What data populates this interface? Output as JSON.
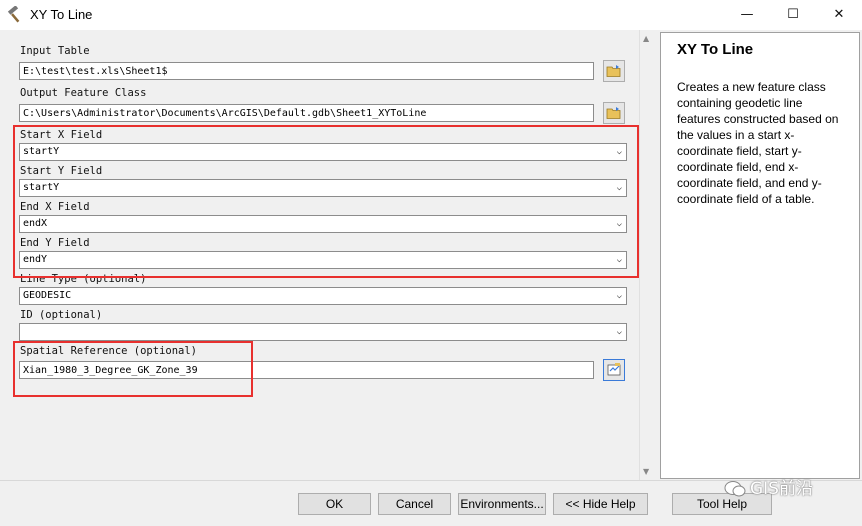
{
  "window": {
    "title": "XY To Line",
    "minimize_glyph": "—",
    "maximize_glyph": "☐",
    "close_glyph": "✕",
    "icon": "hammer-icon"
  },
  "params": {
    "input_table": {
      "label": "Input Table",
      "value": "E:\\test\\test.xls\\Sheet1$"
    },
    "output_feature_class": {
      "label": "Output Feature Class",
      "value": "C:\\Users\\Administrator\\Documents\\ArcGIS\\Default.gdb\\Sheet1_XYToLine"
    },
    "start_x": {
      "label": "Start X Field",
      "value": "startY"
    },
    "start_y": {
      "label": "Start Y Field",
      "value": "startY"
    },
    "end_x": {
      "label": "End X Field",
      "value": "endX"
    },
    "end_y": {
      "label": "End Y Field",
      "value": "endY"
    },
    "line_type": {
      "label": "Line Type (optional)",
      "value": "GEODESIC"
    },
    "id": {
      "label": "ID (optional)",
      "value": ""
    },
    "spatial_reference": {
      "label": "Spatial Reference (optional)",
      "value": "Xian_1980_3_Degree_GK_Zone_39"
    }
  },
  "help": {
    "title": "XY To Line",
    "description": "Creates a new feature class containing geodetic line features constructed based on the values in a start x-coordinate field, start y-coordinate field, end x-coordinate field, and end y-coordinate field of a table."
  },
  "buttons": {
    "ok": "OK",
    "cancel": "Cancel",
    "environments": "Environments...",
    "hide_help": "<< Hide Help",
    "tool_help": "Tool Help"
  },
  "watermark": "GIS前沿",
  "colors": {
    "highlight": "#e8302e",
    "help_bg": "#ffffff",
    "dialog_bg": "#f0f0f0"
  }
}
